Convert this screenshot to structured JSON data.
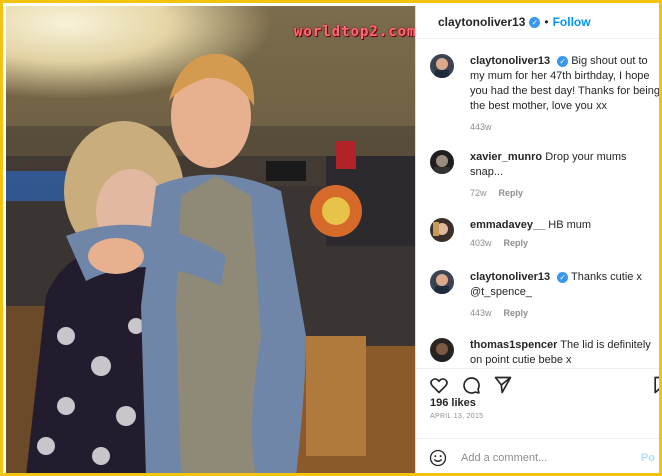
{
  "watermark": "worldtop2.com",
  "post": {
    "username": "claytonoliver13",
    "separator": "•",
    "follow_label": "Follow",
    "verified_badge": "✓"
  },
  "comments": [
    {
      "username": "claytonoliver13",
      "verified": true,
      "text": "Big shout out to my mum for her 47th birthday, I hope you had the best day! Thanks for being the best mother, love you xx",
      "time": "443w",
      "reply": ""
    },
    {
      "username": "xavier_munro",
      "verified": false,
      "text": "Drop your mums snap...",
      "time": "72w",
      "reply": "Reply"
    },
    {
      "username": "emmadavey__",
      "verified": false,
      "text": "HB mum",
      "time": "403w",
      "reply": "Reply"
    },
    {
      "username": "claytonoliver13",
      "verified": true,
      "text": "Thanks cutie x @t_spence_",
      "time": "443w",
      "reply": "Reply"
    },
    {
      "username": "thomas1spencer",
      "verified": false,
      "text": "The lid is definitely on point cutie bebe x",
      "time": "",
      "reply": ""
    }
  ],
  "actions": {
    "icons": [
      "heart-icon",
      "comment-icon",
      "share-icon",
      "bookmark-icon"
    ]
  },
  "likes": "196 likes",
  "date": "APRIL 13, 2015",
  "add_comment": {
    "placeholder": "Add a comment...",
    "post_label": "Po"
  },
  "colors": {
    "accent": "#0095f6",
    "frame": "#f2c40f",
    "muted": "#8e8e8e"
  }
}
